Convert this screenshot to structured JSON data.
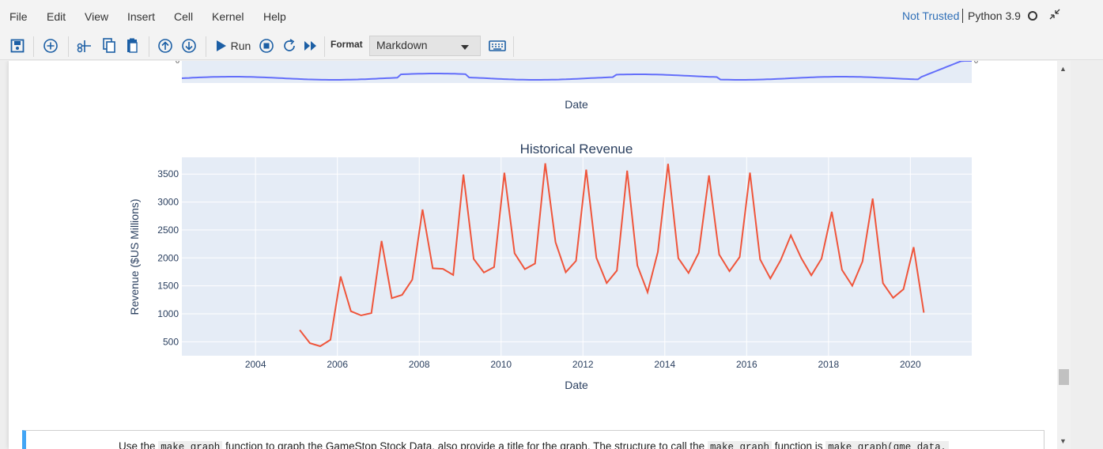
{
  "menu": {
    "items": [
      "File",
      "Edit",
      "View",
      "Insert",
      "Cell",
      "Kernel",
      "Help"
    ],
    "trust_status": "Not Trusted",
    "kernel": "Python 3.9"
  },
  "toolbar": {
    "run_label": "Run",
    "format_label": "Format",
    "format_value": "Markdown",
    "icons": [
      "save-icon",
      "add-cell-icon",
      "cut-icon",
      "copy-icon",
      "paste-icon",
      "move-up-icon",
      "move-down-icon",
      "run-icon",
      "stop-icon",
      "restart-icon",
      "fast-forward-icon",
      "keyboard-icon"
    ]
  },
  "top_chart": {
    "xlabel": "Date",
    "series_color": "#636efa"
  },
  "chart_data": {
    "type": "line",
    "title": "Historical Revenue",
    "xlabel": "Date",
    "ylabel": "Revenue ($US Millions)",
    "xlim": [
      2002.2,
      2021.5
    ],
    "ylim": [
      250,
      3800
    ],
    "x_ticks": [
      2004,
      2006,
      2008,
      2010,
      2012,
      2014,
      2016,
      2018,
      2020
    ],
    "y_ticks": [
      500,
      1000,
      1500,
      2000,
      2500,
      3000,
      3500
    ],
    "grid": true,
    "series": [
      {
        "color": "#ef553b",
        "x": [
          2005.08,
          2005.33,
          2005.58,
          2005.83,
          2006.08,
          2006.33,
          2006.58,
          2006.83,
          2007.08,
          2007.33,
          2007.58,
          2007.83,
          2008.08,
          2008.33,
          2008.58,
          2008.83,
          2009.08,
          2009.33,
          2009.58,
          2009.83,
          2010.08,
          2010.33,
          2010.58,
          2010.83,
          2011.08,
          2011.33,
          2011.58,
          2011.83,
          2012.08,
          2012.33,
          2012.58,
          2012.83,
          2013.08,
          2013.33,
          2013.58,
          2013.83,
          2014.08,
          2014.33,
          2014.58,
          2014.83,
          2015.08,
          2015.33,
          2015.58,
          2015.83,
          2016.08,
          2016.33,
          2016.58,
          2016.83,
          2017.08,
          2017.33,
          2017.58,
          2017.83,
          2018.08,
          2018.33,
          2018.58,
          2018.83,
          2019.08,
          2019.33,
          2019.58,
          2019.83,
          2020.08,
          2020.33
        ],
        "y": [
          709,
          475,
          420,
          534,
          1667,
          1046,
          971,
          1012,
          2304,
          1279,
          1338,
          1611,
          2866,
          1814,
          1804,
          1696,
          3492,
          1981,
          1739,
          1835,
          3524,
          2083,
          1799,
          1899,
          3693,
          2281,
          1744,
          1947,
          3579,
          2002,
          1550,
          1773,
          3562,
          1865,
          1386,
          2107,
          3684,
          1996,
          1731,
          2092,
          3476,
          2061,
          1762,
          2016,
          3525,
          1972,
          1632,
          1959,
          2403,
          2001,
          1688,
          1986,
          2825,
          1786,
          1501,
          1935,
          3063,
          1548,
          1286,
          1439,
          2194,
          1021
        ]
      }
    ]
  },
  "markdown_cell": {
    "text_1": "Use the",
    "code_1": "make_graph",
    "text_2": "function to graph the GameStop Stock Data, also provide a title for the graph. The structure to call the",
    "code_2": "make_graph",
    "text_3": "function is",
    "code_3": "make_graph(gme_data,"
  }
}
